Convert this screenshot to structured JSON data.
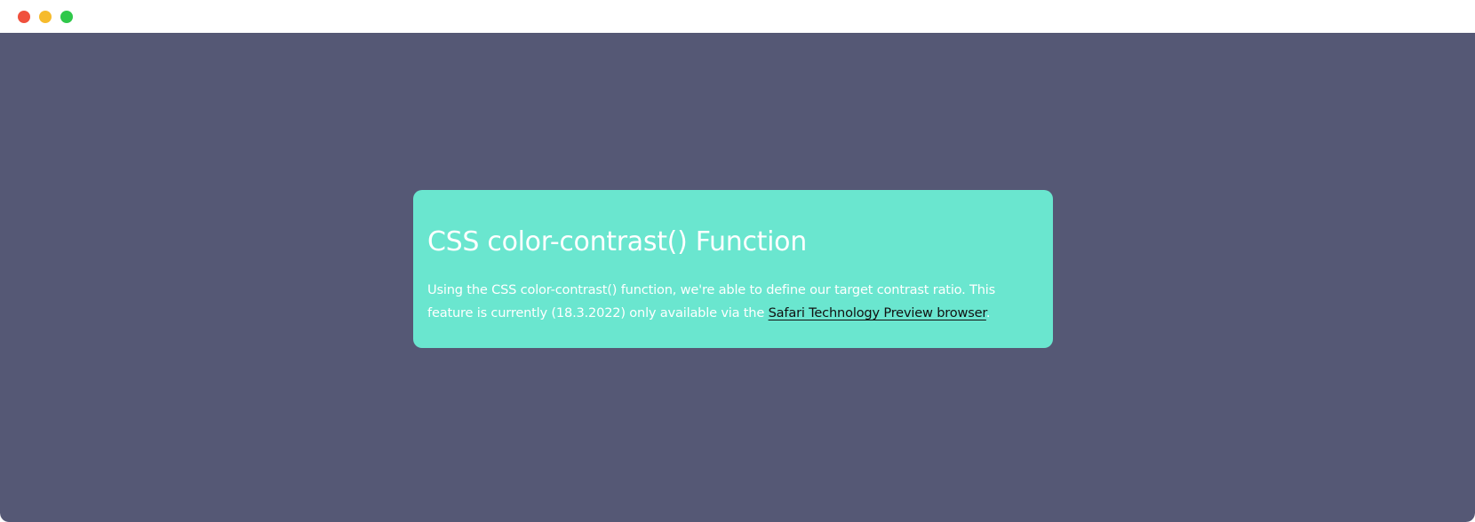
{
  "colors": {
    "page_background": "#555875",
    "card_background": "#6ae6cf",
    "window_close": "#f0503d",
    "window_minimize": "#f6bb2c",
    "window_zoom": "#2fc84a",
    "heading_text": "#ffffff",
    "body_text": "#ffffff",
    "link_text": "#111111"
  },
  "window": {
    "controls": [
      "close-control",
      "minimize-control",
      "zoom-control"
    ]
  },
  "card": {
    "title": "CSS color-contrast() Function",
    "text_before_link": "Using the CSS color-contrast() function, we're able to define our target contrast ratio. This feature is currently (18.3.2022) only available via the ",
    "link_text": "Safari Technology Preview browser",
    "text_after_link": "."
  }
}
